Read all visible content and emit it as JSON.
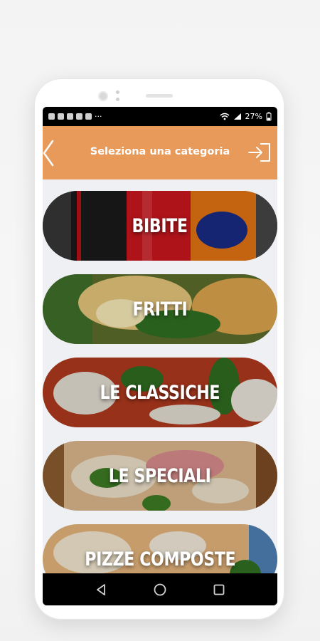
{
  "status_bar": {
    "battery_percent": "27%",
    "more_indicator": "···"
  },
  "header": {
    "title": "Seleziona una categoria"
  },
  "categories": [
    {
      "label": "BIBITE"
    },
    {
      "label": "FRITTI"
    },
    {
      "label": "LE CLASSICHE"
    },
    {
      "label": "LE SPECIALI"
    },
    {
      "label": "PIZZE COMPOSTE"
    }
  ],
  "icons": {
    "back": "chevron-left-icon",
    "login": "login-icon",
    "nav_back": "triangle-back-icon",
    "nav_home": "circle-home-icon",
    "nav_recents": "square-recents-icon"
  },
  "colors": {
    "accent": "#e89a5a",
    "content_bg": "#eef0f3"
  }
}
